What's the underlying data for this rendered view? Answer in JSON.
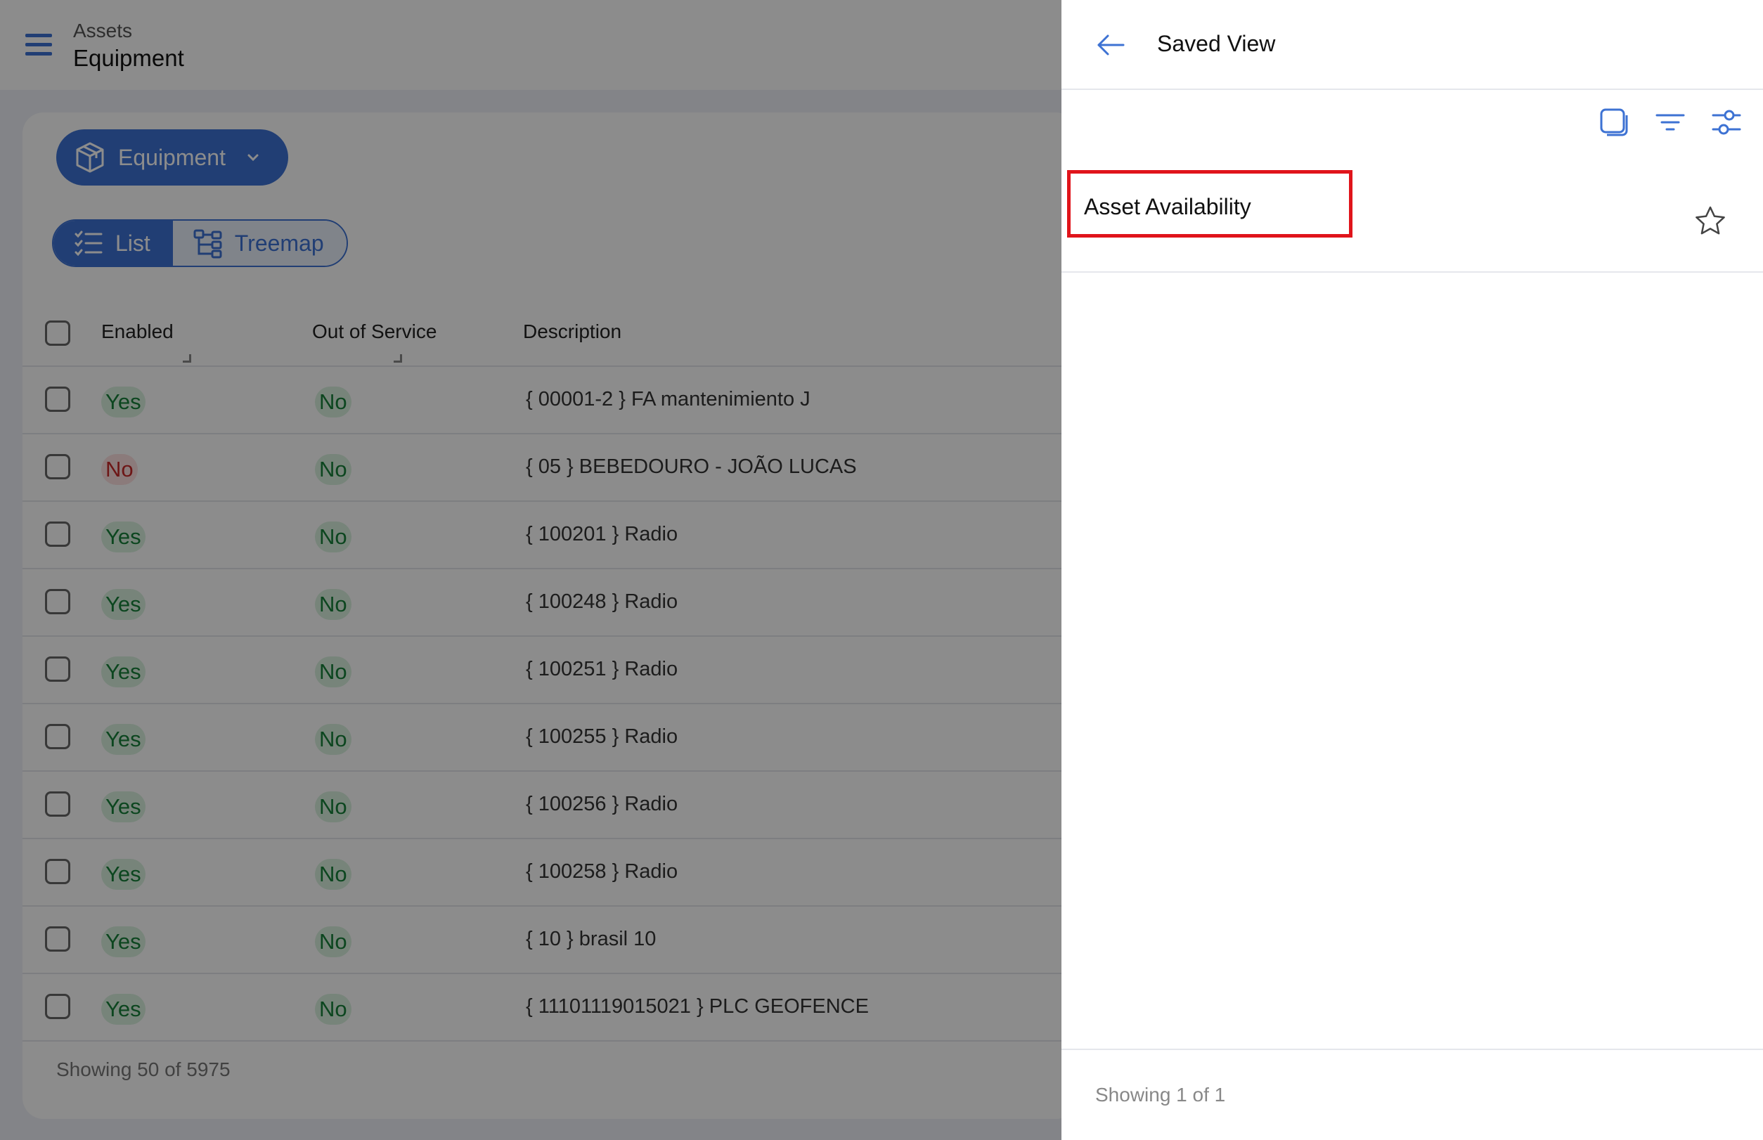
{
  "header": {
    "breadcrumb_parent": "Assets",
    "title": "Equipment"
  },
  "entity_selector": {
    "label": "Equipment"
  },
  "view_toggle": {
    "list_label": "List",
    "treemap_label": "Treemap",
    "active": "List"
  },
  "table": {
    "columns": [
      "Enabled",
      "Out of Service",
      "Description"
    ],
    "rows": [
      {
        "enabled": "Yes",
        "out_of_service": "No",
        "description": "{ 00001-2 } FA mantenimiento J"
      },
      {
        "enabled": "No",
        "out_of_service": "No",
        "description": "{ 05 } BEBEDOURO - JOÃO LUCAS"
      },
      {
        "enabled": "Yes",
        "out_of_service": "No",
        "description": "{ 100201 } Radio"
      },
      {
        "enabled": "Yes",
        "out_of_service": "No",
        "description": "{ 100248 } Radio"
      },
      {
        "enabled": "Yes",
        "out_of_service": "No",
        "description": "{ 100251 } Radio"
      },
      {
        "enabled": "Yes",
        "out_of_service": "No",
        "description": "{ 100255 } Radio"
      },
      {
        "enabled": "Yes",
        "out_of_service": "No",
        "description": "{ 100256 } Radio"
      },
      {
        "enabled": "Yes",
        "out_of_service": "No",
        "description": "{ 100258 } Radio"
      },
      {
        "enabled": "Yes",
        "out_of_service": "No",
        "description": "{ 10 } brasil 10"
      },
      {
        "enabled": "Yes",
        "out_of_service": "No",
        "description": "{ 11101119015021 } PLC GEOFENCE"
      }
    ],
    "footer": "Showing 50 of 5975"
  },
  "panel": {
    "title": "Saved View",
    "items": [
      {
        "name": "Asset Availability"
      }
    ],
    "footer": "Showing 1 of 1"
  },
  "colors": {
    "accent": "#3d72d3",
    "highlight": "#e0141b",
    "yes": "#17803a",
    "no": "#c62828"
  }
}
